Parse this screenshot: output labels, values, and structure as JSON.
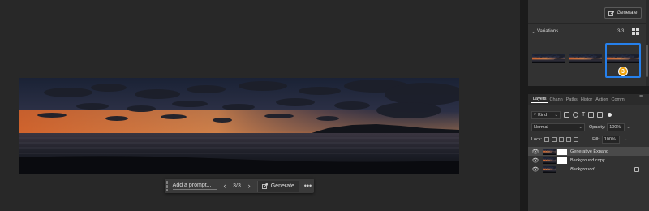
{
  "taskbar": {
    "prompt_placeholder": "Add a prompt...",
    "prev_icon": "chevron-left-icon",
    "next_icon": "chevron-right-icon",
    "counter": "3/3",
    "generate_label": "Generate",
    "more_label": "•••"
  },
  "properties": {
    "generate_label": "Generate",
    "variations": {
      "title": "Variations",
      "count": "3/3",
      "selected_index": 3,
      "badge": "3"
    }
  },
  "layers_panel": {
    "tabs": [
      {
        "label": "Layers",
        "active": true
      },
      {
        "label": "Chann",
        "active": false
      },
      {
        "label": "Paths",
        "active": false
      },
      {
        "label": "Histor",
        "active": false
      },
      {
        "label": "Action",
        "active": false
      },
      {
        "label": "Comm",
        "active": false
      }
    ],
    "filter_kind": "Kind",
    "blend_mode": "Normal",
    "opacity_label": "Opacity:",
    "opacity_value": "100%",
    "lock_label": "Lock:",
    "fill_label": "Fill:",
    "fill_value": "100%",
    "layers": [
      {
        "name": "Generative Expand",
        "selected": true
      },
      {
        "name": "Background copy",
        "selected": false
      },
      {
        "name": "Background",
        "selected": false,
        "locked": true
      }
    ]
  },
  "colors": {
    "accent": "#2680eb",
    "badge": "#f0a30a",
    "canvas_bg": "#282828",
    "panel_bg": "#323232"
  }
}
